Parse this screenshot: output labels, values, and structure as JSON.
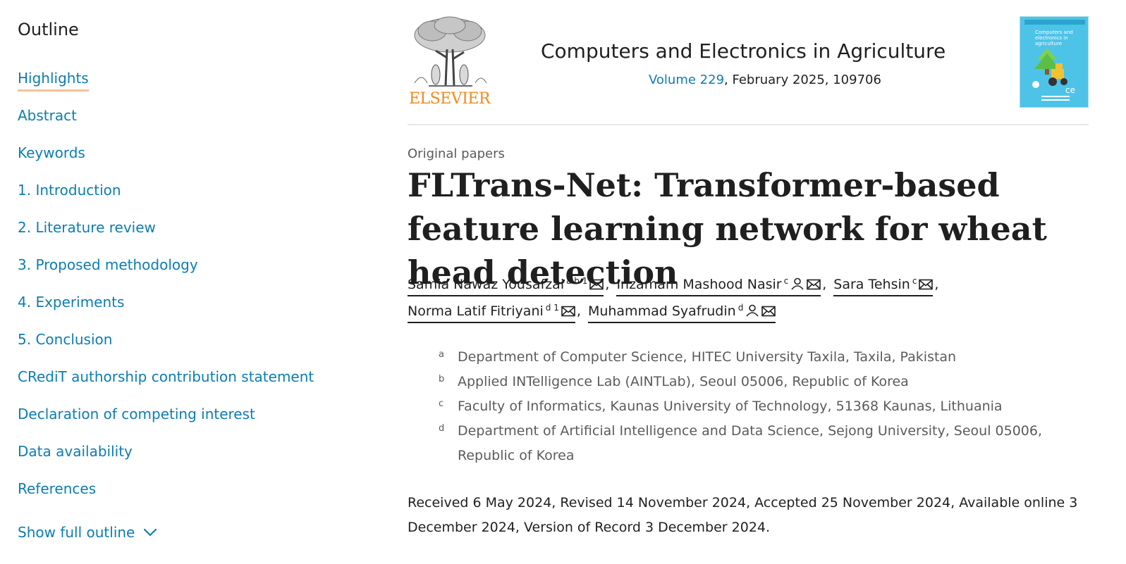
{
  "outline": {
    "title": "Outline",
    "items": [
      {
        "label": "Highlights"
      },
      {
        "label": "Abstract"
      },
      {
        "label": "Keywords"
      },
      {
        "label": "1. Introduction"
      },
      {
        "label": "2. Literature review"
      },
      {
        "label": "3. Proposed methodology"
      },
      {
        "label": "4. Experiments"
      },
      {
        "label": "5. Conclusion"
      },
      {
        "label": "CRediT authorship contribution statement"
      },
      {
        "label": "Declaration of competing interest"
      },
      {
        "label": "Data availability"
      },
      {
        "label": "References"
      }
    ],
    "active_item": "Highlights",
    "show_full_outline": "Show full outline"
  },
  "header": {
    "publisher": "ELSEVIER",
    "journal_title": "Computers and Electronics in Agriculture",
    "volume_link": "Volume 229",
    "issue_info": ", February 2025, 109706",
    "cover_text": "Computers and electronics in agriculture"
  },
  "article": {
    "type": "Original papers",
    "title": "FLTrans-Net: Transformer-based feature learning network for wheat head detection",
    "authors": [
      {
        "name": "Samia Nawaz Yousafzai",
        "affiliations": "a b 1",
        "icons": [
          "envelope"
        ]
      },
      {
        "name": "Inzamam Mashood Nasir",
        "affiliations": "c",
        "icons": [
          "person",
          "envelope"
        ]
      },
      {
        "name": "Sara Tehsin",
        "affiliations": "c",
        "icons": [
          "envelope"
        ]
      },
      {
        "name": "Norma Latif Fitriyani",
        "affiliations": "d 1",
        "icons": [
          "envelope"
        ]
      },
      {
        "name": "Muhammad Syafrudin",
        "affiliations": "d",
        "icons": [
          "person",
          "envelope"
        ]
      }
    ],
    "separator": ",",
    "affiliations": [
      {
        "label": "a",
        "text": "Department of Computer Science, HITEC University Taxila, Taxila, Pakistan"
      },
      {
        "label": "b",
        "text": "Applied INTelligence Lab (AINTLab), Seoul 05006, Republic of Korea"
      },
      {
        "label": "c",
        "text": "Faculty of Informatics, Kaunas University of Technology, 51368 Kaunas, Lithuania"
      },
      {
        "label": "d",
        "text": "Department of Artificial Intelligence and Data Science, Sejong University, Seoul 05006, Republic of Korea"
      }
    ],
    "history": "Received 6 May 2024, Revised 14 November 2024, Accepted 25 November 2024, Available online 3 December 2024, Version of Record 3 December 2024."
  },
  "colors": {
    "link": "#0c7db1",
    "active_underline": "#f7c09d",
    "publisher_orange": "#f28a1b",
    "cover_blue": "#4ec3e8",
    "muted_text": "#5b5b5b"
  }
}
